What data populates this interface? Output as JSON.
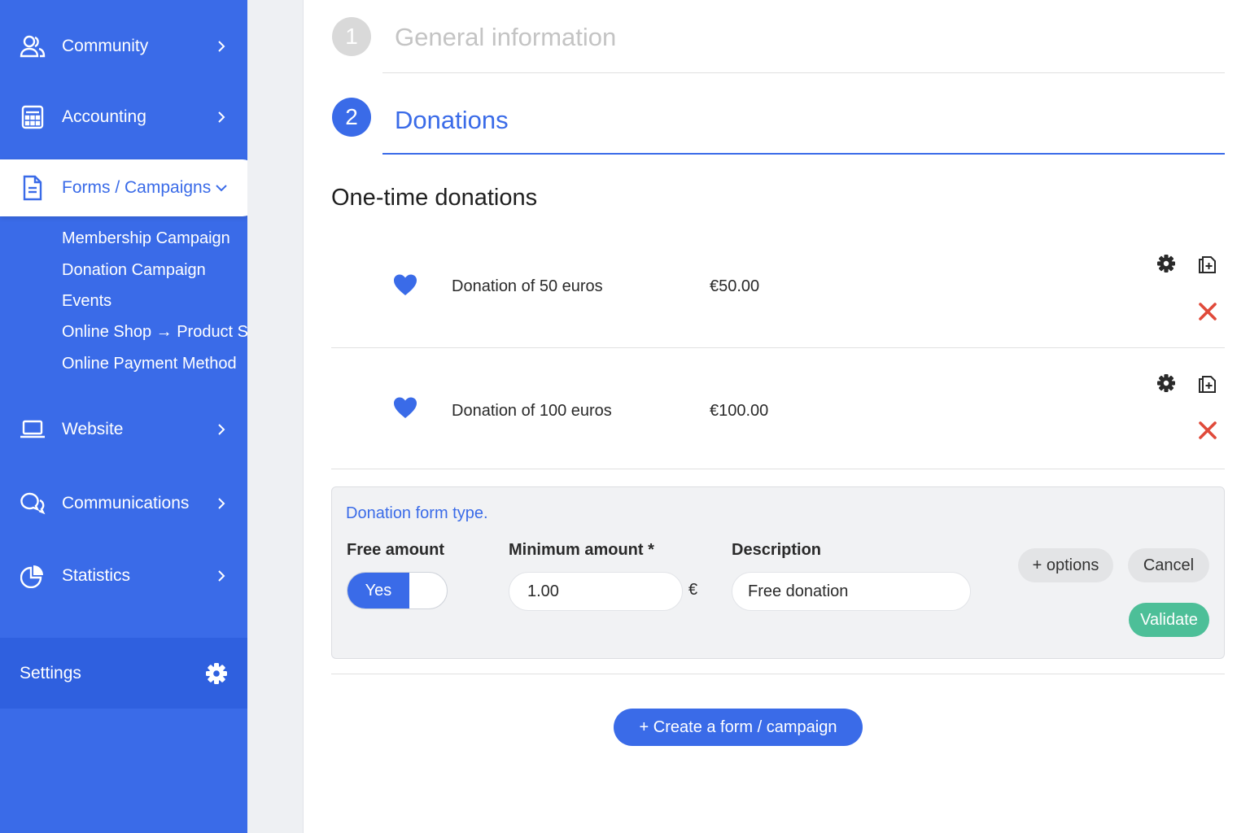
{
  "sidebar": {
    "items": [
      {
        "label": "Community",
        "icon": "community-icon"
      },
      {
        "label": "Accounting",
        "icon": "calculator-icon"
      },
      {
        "label": "Forms / Campaigns",
        "icon": "document-icon"
      },
      {
        "label": "Website",
        "icon": "laptop-icon"
      },
      {
        "label": "Communications",
        "icon": "chat-icon"
      },
      {
        "label": "Statistics",
        "icon": "pie-chart-icon"
      }
    ],
    "subitems": [
      "Membership Campaign",
      "Donation Campaign",
      "Events",
      "Online Shop → Product Sales",
      "Online Payment Method"
    ],
    "settings_label": "Settings"
  },
  "steps": [
    {
      "number": "1",
      "title": "General information"
    },
    {
      "number": "2",
      "title": "Donations"
    }
  ],
  "section_title": "One-time donations",
  "donations": [
    {
      "label": "Donation of 50 euros",
      "amount": "€50.00"
    },
    {
      "label": "Donation of 100 euros",
      "amount": "€100.00"
    }
  ],
  "form": {
    "title": "Donation form type.",
    "free_amount_label": "Free amount",
    "free_amount_value": "Yes",
    "minimum_label": "Minimum amount *",
    "minimum_value": "1.00",
    "currency": "€",
    "description_label": "Description",
    "description_value": "Free donation",
    "options_label": "+ options",
    "cancel_label": "Cancel",
    "validate_label": "Validate"
  },
  "create_button": "+ Create a form / campaign",
  "colors": {
    "primary": "#3a6be8",
    "validate": "#4dbf98",
    "delete": "#e04a3a"
  }
}
